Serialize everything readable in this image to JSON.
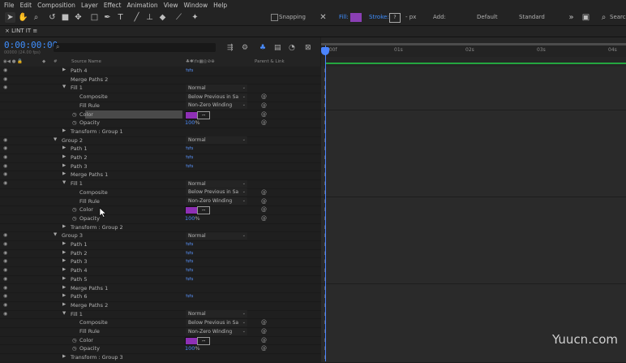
{
  "menu": [
    "File",
    "Edit",
    "Composition",
    "Layer",
    "Effect",
    "Animation",
    "View",
    "Window",
    "Help"
  ],
  "toolbar": {
    "snapping": "Snapping",
    "fill": "Fill:",
    "stroke": "Stroke:",
    "stroke_value": "?",
    "px": "- px",
    "add": "Add:",
    "default": "Default",
    "standard": "Standard",
    "search": "Search",
    "fill_color": "#8a3fb4"
  },
  "tab": {
    "title": "LINT IT",
    "menu": "≡"
  },
  "panel": {
    "timecode": "0:00:00:00",
    "fps": "00000 (24.00 fps)",
    "search_icon": "⌕"
  },
  "columns": {
    "source_name": "Source Name",
    "parent_link": "Parent & Link",
    "hash": "#"
  },
  "rows": [
    {
      "indent": 1,
      "twirl": "▶",
      "name": "Path 4",
      "eye": true,
      "icon": "path"
    },
    {
      "indent": 1,
      "twirl": "",
      "name": "Merge Paths 2",
      "eye": true
    },
    {
      "indent": 1,
      "twirl": "▼",
      "name": "Fill 1",
      "eye": true,
      "dropdown": "Normal"
    },
    {
      "indent": 2,
      "name": "Composite",
      "dropdown": "Below Previous in Sa",
      "spiral": true
    },
    {
      "indent": 2,
      "name": "Fill Rule",
      "dropdown": "Non-Zero Winding",
      "spiral": true
    },
    {
      "indent": 2,
      "name": "Color",
      "stopwatch": true,
      "color": true,
      "spiral": true,
      "selected": true
    },
    {
      "indent": 2,
      "name": "Opacity",
      "stopwatch": true,
      "pct": "100",
      "spiral": true
    },
    {
      "indent": 1,
      "twirl": "▶",
      "name": "Transform : Group 1"
    },
    {
      "indent": 0,
      "twirl": "▼",
      "name": "Group 2",
      "eye": true,
      "dropdown": "Normal"
    },
    {
      "indent": 1,
      "twirl": "▶",
      "name": "Path 1",
      "eye": true,
      "icon": "path"
    },
    {
      "indent": 1,
      "twirl": "▶",
      "name": "Path 2",
      "eye": true,
      "icon": "path"
    },
    {
      "indent": 1,
      "twirl": "▶",
      "name": "Path 3",
      "eye": true,
      "icon": "path"
    },
    {
      "indent": 1,
      "twirl": "▶",
      "name": "Merge Paths 1",
      "eye": true
    },
    {
      "indent": 1,
      "twirl": "▼",
      "name": "Fill 1",
      "eye": true,
      "dropdown": "Normal"
    },
    {
      "indent": 2,
      "name": "Composite",
      "dropdown": "Below Previous in Sa",
      "spiral": true
    },
    {
      "indent": 2,
      "name": "Fill Rule",
      "dropdown": "Non-Zero Winding",
      "spiral": true
    },
    {
      "indent": 2,
      "name": "Color",
      "stopwatch": true,
      "color": true,
      "spiral": true
    },
    {
      "indent": 2,
      "name": "Opacity",
      "stopwatch": true,
      "pct": "100",
      "spiral": true
    },
    {
      "indent": 1,
      "twirl": "▶",
      "name": "Transform : Group 2"
    },
    {
      "indent": 0,
      "twirl": "▼",
      "name": "Group 3",
      "eye": true,
      "dropdown": "Normal"
    },
    {
      "indent": 1,
      "twirl": "▶",
      "name": "Path 1",
      "eye": true,
      "icon": "path"
    },
    {
      "indent": 1,
      "twirl": "▶",
      "name": "Path 2",
      "eye": true,
      "icon": "path"
    },
    {
      "indent": 1,
      "twirl": "▶",
      "name": "Path 3",
      "eye": true,
      "icon": "path"
    },
    {
      "indent": 1,
      "twirl": "▶",
      "name": "Path 4",
      "eye": true,
      "icon": "path"
    },
    {
      "indent": 1,
      "twirl": "▶",
      "name": "Path 5",
      "eye": true,
      "icon": "path"
    },
    {
      "indent": 1,
      "twirl": "▶",
      "name": "Merge Paths 1",
      "eye": true
    },
    {
      "indent": 1,
      "twirl": "▶",
      "name": "Path 6",
      "eye": true,
      "icon": "path"
    },
    {
      "indent": 1,
      "twirl": "▶",
      "name": "Merge Paths 2",
      "eye": true
    },
    {
      "indent": 1,
      "twirl": "▼",
      "name": "Fill 1",
      "eye": true,
      "dropdown": "Normal"
    },
    {
      "indent": 2,
      "name": "Composite",
      "dropdown": "Below Previous in Sa",
      "spiral": true
    },
    {
      "indent": 2,
      "name": "Fill Rule",
      "dropdown": "Non-Zero Winding",
      "spiral": true
    },
    {
      "indent": 2,
      "name": "Color",
      "stopwatch": true,
      "color": true,
      "spiral": true
    },
    {
      "indent": 2,
      "name": "Opacity",
      "stopwatch": true,
      "pct": "100",
      "spiral": true
    },
    {
      "indent": 1,
      "twirl": "▶",
      "name": "Transform : Group 3"
    }
  ],
  "timeline": {
    "ticks": [
      "0:00f",
      "01s",
      "02s",
      "03s",
      "04s"
    ]
  },
  "watermark": "Yuucn.com",
  "colors": {
    "accent": "#3f8fff",
    "fill_purple": "#8e2fb5",
    "work_area": "#24a640"
  }
}
